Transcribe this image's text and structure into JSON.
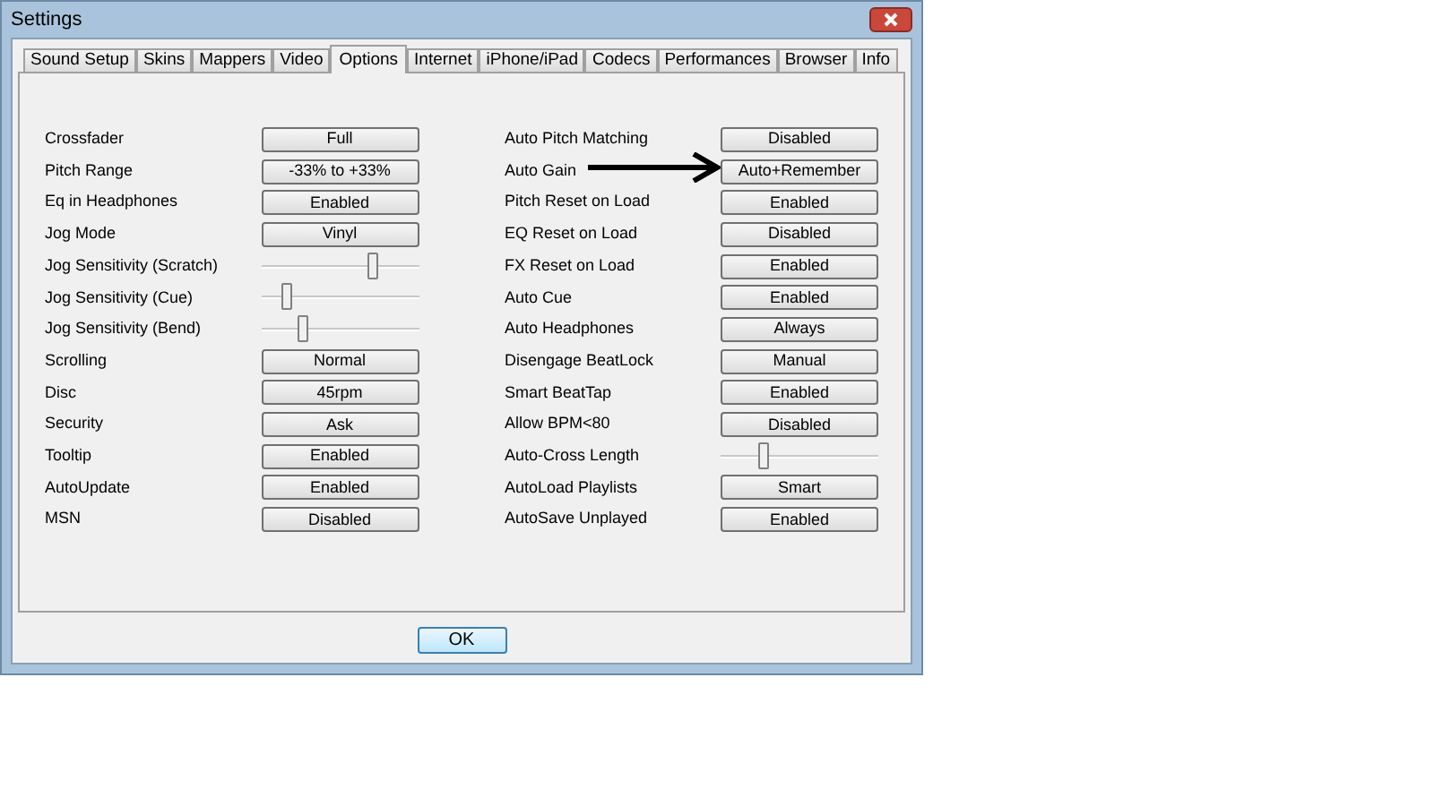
{
  "window": {
    "title": "Settings"
  },
  "tabs": [
    {
      "label": "Sound Setup",
      "selected": false
    },
    {
      "label": "Skins",
      "selected": false
    },
    {
      "label": "Mappers",
      "selected": false
    },
    {
      "label": "Video",
      "selected": false
    },
    {
      "label": "Options",
      "selected": true
    },
    {
      "label": "Internet",
      "selected": false
    },
    {
      "label": "iPhone/iPad",
      "selected": false
    },
    {
      "label": "Codecs",
      "selected": false
    },
    {
      "label": "Performances",
      "selected": false
    },
    {
      "label": "Browser",
      "selected": false
    },
    {
      "label": "Info",
      "selected": false
    }
  ],
  "left_options": [
    {
      "kind": "button",
      "label": "Crossfader",
      "value": "Full"
    },
    {
      "kind": "button",
      "label": "Pitch Range",
      "value": "-33% to +33%"
    },
    {
      "kind": "button",
      "label": "Eq in Headphones",
      "value": "Enabled"
    },
    {
      "kind": "button",
      "label": "Jog Mode",
      "value": "Vinyl"
    },
    {
      "kind": "slider",
      "label": "Jog Sensitivity (Scratch)",
      "level": 0.72
    },
    {
      "kind": "slider",
      "label": "Jog Sensitivity (Cue)",
      "level": 0.14
    },
    {
      "kind": "slider",
      "label": "Jog Sensitivity (Bend)",
      "level": 0.25
    },
    {
      "kind": "button",
      "label": "Scrolling",
      "value": "Normal"
    },
    {
      "kind": "button",
      "label": "Disc",
      "value": "45rpm"
    },
    {
      "kind": "button",
      "label": "Security",
      "value": "Ask"
    },
    {
      "kind": "button",
      "label": "Tooltip",
      "value": "Enabled"
    },
    {
      "kind": "button",
      "label": "AutoUpdate",
      "value": "Enabled"
    },
    {
      "kind": "button",
      "label": "MSN",
      "value": "Disabled"
    }
  ],
  "right_options": [
    {
      "kind": "button",
      "label": "Auto Pitch Matching",
      "value": "Disabled"
    },
    {
      "kind": "button",
      "label": "Auto Gain",
      "value": "Auto+Remember"
    },
    {
      "kind": "button",
      "label": "Pitch Reset on Load",
      "value": "Enabled"
    },
    {
      "kind": "button",
      "label": "EQ Reset on Load",
      "value": "Disabled"
    },
    {
      "kind": "button",
      "label": "FX Reset on Load",
      "value": "Enabled"
    },
    {
      "kind": "button",
      "label": "Auto Cue",
      "value": "Enabled"
    },
    {
      "kind": "button",
      "label": "Auto Headphones",
      "value": "Always"
    },
    {
      "kind": "button",
      "label": "Disengage BeatLock",
      "value": "Manual"
    },
    {
      "kind": "button",
      "label": "Smart BeatTap",
      "value": "Enabled"
    },
    {
      "kind": "button",
      "label": "Allow BPM<80",
      "value": "Disabled"
    },
    {
      "kind": "slider",
      "label": "Auto-Cross Length",
      "level": 0.26
    },
    {
      "kind": "button",
      "label": "AutoLoad Playlists",
      "value": "Smart"
    },
    {
      "kind": "button",
      "label": "AutoSave Unplayed",
      "value": "Enabled"
    }
  ],
  "buttons": [
    "OK"
  ]
}
